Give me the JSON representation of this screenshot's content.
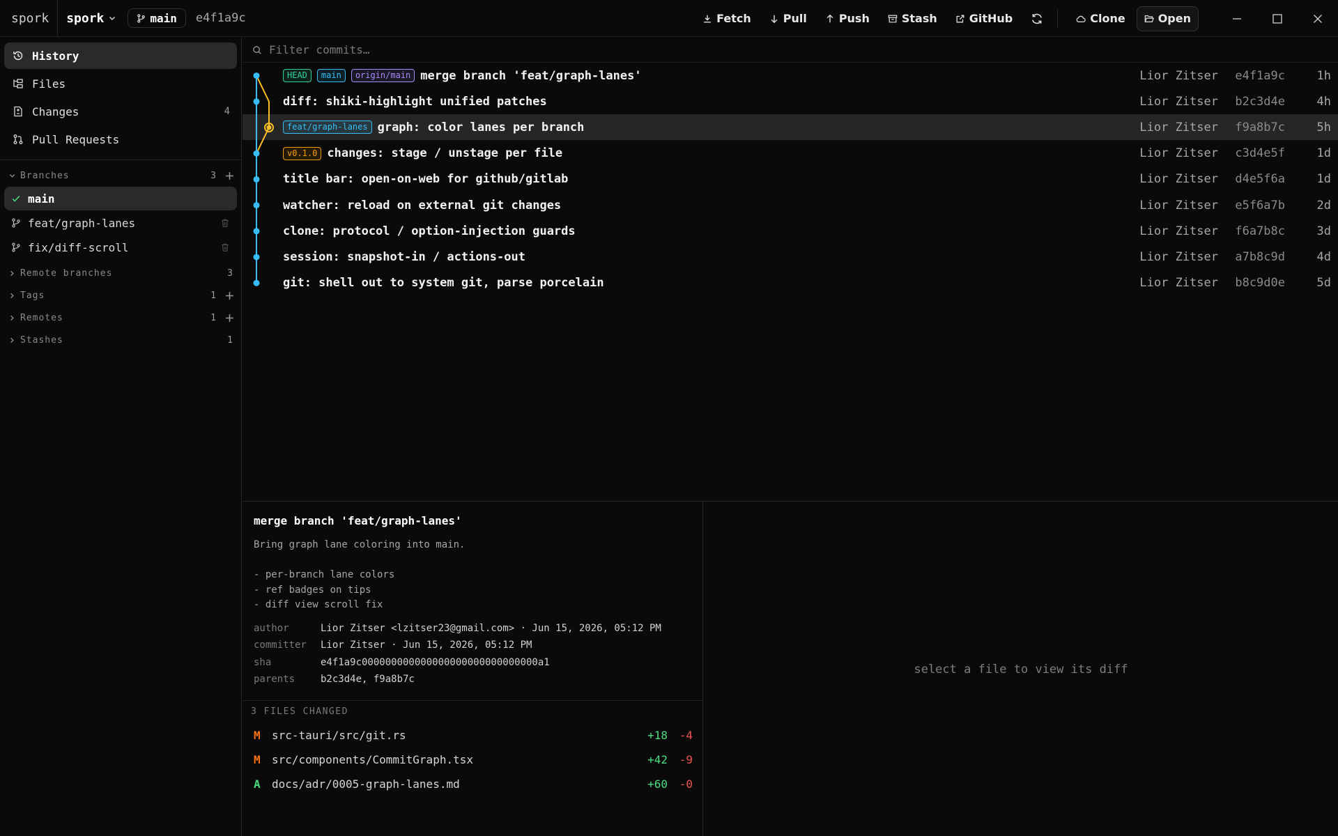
{
  "titlebar": {
    "app_name": "spork",
    "repo": "spork",
    "branch": "main",
    "head_sha": "e4f1a9c",
    "buttons": {
      "fetch": "Fetch",
      "pull": "Pull",
      "push": "Push",
      "stash": "Stash",
      "github": "GitHub",
      "clone": "Clone",
      "open": "Open"
    },
    "icons": [
      "download-icon",
      "arrow-down-icon",
      "arrow-up-icon",
      "archive-icon",
      "external-link-icon",
      "refresh-icon",
      "cloud-icon",
      "folder-open-icon",
      "minimize-icon",
      "maximize-icon",
      "close-icon"
    ]
  },
  "sidebar": {
    "nav": [
      {
        "label": "History",
        "count": ""
      },
      {
        "label": "Files",
        "count": ""
      },
      {
        "label": "Changes",
        "count": "4"
      },
      {
        "label": "Pull Requests",
        "count": ""
      }
    ],
    "branches": {
      "label": "Branches",
      "count": "3",
      "items": [
        {
          "name": "main"
        },
        {
          "name": "feat/graph-lanes"
        },
        {
          "name": "fix/diff-scroll"
        }
      ]
    },
    "remote_branches": {
      "label": "Remote branches",
      "count": "3"
    },
    "tags": {
      "label": "Tags",
      "count": "1"
    },
    "remotes": {
      "label": "Remotes",
      "count": "1"
    },
    "stashes": {
      "label": "Stashes",
      "count": "1"
    }
  },
  "commits": {
    "filter_placeholder": "Filter commits…",
    "rows": [
      {
        "badges": [
          {
            "text": "HEAD",
            "color": "#34d399"
          },
          {
            "text": "main",
            "color": "#38bdf8"
          },
          {
            "text": "origin/main",
            "color": "#a78bfa"
          }
        ],
        "message": "merge branch 'feat/graph-lanes'",
        "author": "Lior Zitser",
        "sha": "e4f1a9c",
        "age": "1h"
      },
      {
        "badges": [],
        "message": "diff: shiki-highlight unified patches",
        "author": "Lior Zitser",
        "sha": "b2c3d4e",
        "age": "4h"
      },
      {
        "badges": [
          {
            "text": "feat/graph-lanes",
            "color": "#38bdf8"
          }
        ],
        "message": "graph: color lanes per branch",
        "author": "Lior Zitser",
        "sha": "f9a8b7c",
        "age": "5h"
      },
      {
        "badges": [
          {
            "text": "v0.1.0",
            "color": "#f59e0b"
          }
        ],
        "message": "changes: stage / unstage per file",
        "author": "Lior Zitser",
        "sha": "c3d4e5f",
        "age": "1d"
      },
      {
        "badges": [],
        "message": "title bar: open-on-web for github/gitlab",
        "author": "Lior Zitser",
        "sha": "d4e5f6a",
        "age": "1d"
      },
      {
        "badges": [],
        "message": "watcher: reload on external git changes",
        "author": "Lior Zitser",
        "sha": "e5f6a7b",
        "age": "2d"
      },
      {
        "badges": [],
        "message": "clone: protocol / option-injection guards",
        "author": "Lior Zitser",
        "sha": "f6a7b8c",
        "age": "3d"
      },
      {
        "badges": [],
        "message": "session: snapshot-in / actions-out",
        "author": "Lior Zitser",
        "sha": "a7b8c9d",
        "age": "4d"
      },
      {
        "badges": [],
        "message": "git: shell out to system git, parse porcelain",
        "author": "Lior Zitser",
        "sha": "b8c9d0e",
        "age": "5d"
      }
    ],
    "lane_colors": {
      "main": "#38bdf8",
      "feature": "#fbbf24"
    }
  },
  "detail": {
    "title": "merge branch 'feat/graph-lanes'",
    "body": "Bring graph lane coloring into main.\n\n- per-branch lane colors\n- ref badges on tips\n- diff view scroll fix",
    "meta": [
      {
        "key": "author",
        "value": "Lior Zitser <lzitser23@gmail.com> · Jun 15, 2026, 05:12 PM"
      },
      {
        "key": "committer",
        "value": "Lior Zitser · Jun 15, 2026, 05:12 PM"
      },
      {
        "key": "sha",
        "value": "e4f1a9c000000000000000000000000000000a1"
      },
      {
        "key": "parents",
        "value": "b2c3d4e, f9a8b7c"
      }
    ],
    "files_header": "3 FILES CHANGED",
    "files": [
      {
        "status": "M",
        "status_color": "#f97316",
        "path": "src-tauri/src/git.rs",
        "additions": "+18",
        "deletions": "-4"
      },
      {
        "status": "M",
        "status_color": "#f97316",
        "path": "src/components/CommitGraph.tsx",
        "additions": "+42",
        "deletions": "-9"
      },
      {
        "status": "A",
        "status_color": "#4ade80",
        "path": "docs/adr/0005-graph-lanes.md",
        "additions": "+60",
        "deletions": "-0"
      }
    ]
  },
  "diff": {
    "empty_text": "select a file to view its diff"
  }
}
